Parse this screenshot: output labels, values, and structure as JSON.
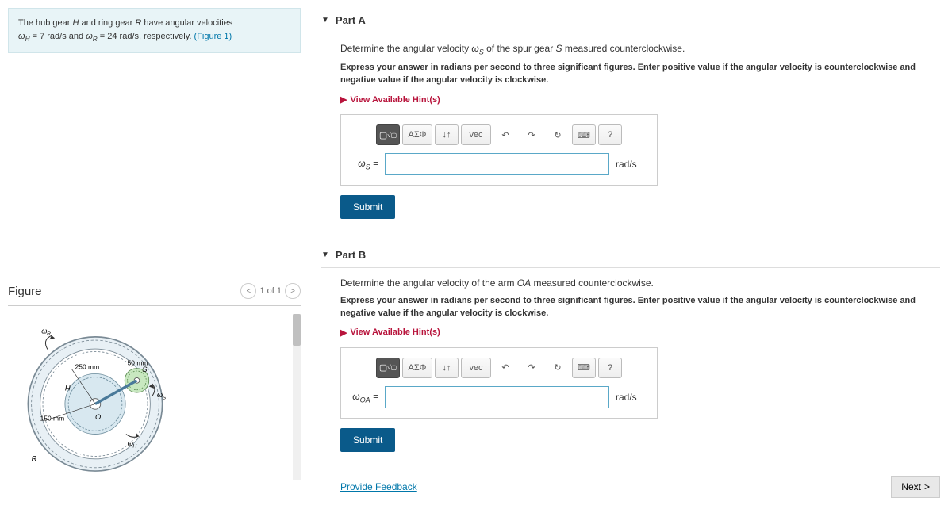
{
  "intro": {
    "text_pre": "The hub gear ",
    "gear_h": "H",
    "text_mid1": " and ring gear ",
    "gear_r": "R",
    "text_mid2": " have angular velocities ",
    "wh_eq": "ω_H = 7 rad/s",
    "text_and": " and ",
    "wr_eq": "ω_R = 24 rad/s",
    "text_end": ", respectively. ",
    "figure_link": "(Figure 1)"
  },
  "figure": {
    "title": "Figure",
    "counter": "1 of 1",
    "labels": {
      "wr": "ω_R",
      "ws": "ω_S",
      "wh": "ω_H",
      "d250": "250 mm",
      "d50": "50 mm",
      "d150": "150 mm",
      "h": "H",
      "r": "R",
      "o": "O",
      "s": "S"
    }
  },
  "partA": {
    "title": "Part A",
    "prompt_pre": "Determine the angular velocity ",
    "prompt_var": "ω_S",
    "prompt_mid": " of the spur gear ",
    "prompt_gear": "S",
    "prompt_end": " measured counterclockwise.",
    "instructions": "Express your answer in radians per second to three significant figures. Enter positive value if the angular velocity is counterclockwise and negative value if the angular velocity is clockwise.",
    "hints": "View Available Hint(s)",
    "var_label": "ω_S =",
    "unit": "rad/s",
    "submit": "Submit"
  },
  "partB": {
    "title": "Part B",
    "prompt_pre": "Determine the angular velocity of the arm ",
    "prompt_var": "OA",
    "prompt_end": " measured counterclockwise.",
    "instructions": "Express your answer in radians per second to three significant figures. Enter positive value if the angular velocity is counterclockwise and negative value if the angular velocity is clockwise.",
    "hints": "View Available Hint(s)",
    "var_label": "ω_OA =",
    "unit": "rad/s",
    "submit": "Submit"
  },
  "toolbar": {
    "template": "▢√▢",
    "greek": "ΑΣΦ",
    "subscript": "↓↑",
    "vec": "vec",
    "undo": "↶",
    "redo": "↷",
    "reset": "↻",
    "keyboard": "⌨",
    "help": "?"
  },
  "footer": {
    "feedback": "Provide Feedback",
    "next": "Next"
  }
}
